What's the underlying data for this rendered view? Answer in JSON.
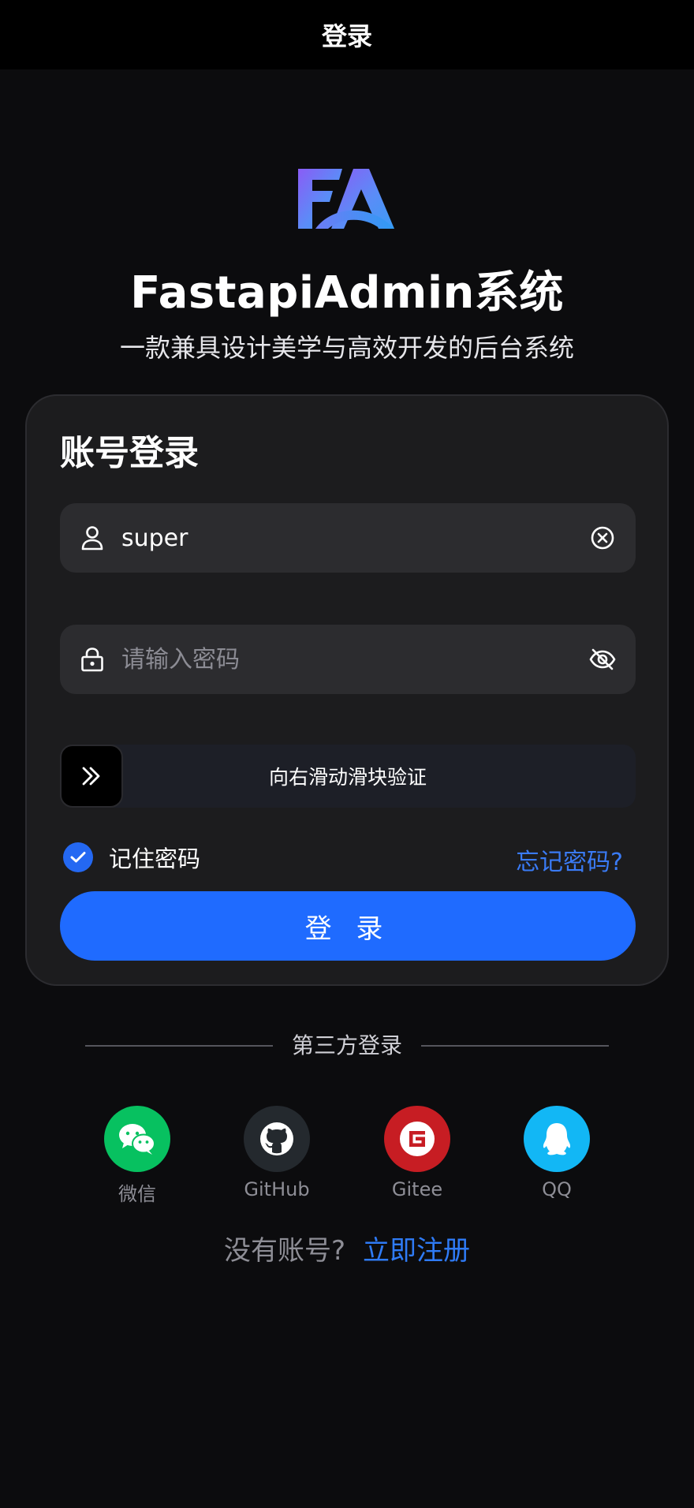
{
  "navbar": {
    "title": "登录"
  },
  "app": {
    "title": "FastapiAdmin系统",
    "subtitle": "一款兼具设计美学与高效开发的后台系统"
  },
  "login_card": {
    "title": "账号登录",
    "username": {
      "value": "super",
      "icon": "user-icon",
      "action_icon": "clear-icon"
    },
    "password": {
      "value": "",
      "placeholder": "请输入密码",
      "icon": "lock-icon",
      "action_icon": "eye-off-icon"
    },
    "slider": {
      "text": "向右滑动滑块验证",
      "icon": "double-chevron-right-icon"
    },
    "remember": {
      "label": "记住密码",
      "checked": true
    },
    "forgot_link": "忘记密码?",
    "login_button": "登 录"
  },
  "third_party": {
    "label": "第三方登录",
    "providers": [
      {
        "name": "微信",
        "icon": "wechat-icon",
        "color": "#07c160"
      },
      {
        "name": "GitHub",
        "icon": "github-icon",
        "color": "#24292e"
      },
      {
        "name": "Gitee",
        "icon": "gitee-icon",
        "color": "#c71d23"
      },
      {
        "name": "QQ",
        "icon": "qq-icon",
        "color": "#12b7f5"
      }
    ]
  },
  "register": {
    "question": "没有账号?",
    "link": "立即注册"
  },
  "colors": {
    "background": "#0c0c0e",
    "card": "#1c1c1e",
    "accent": "#1f6bff",
    "link": "#3a7bf6"
  }
}
